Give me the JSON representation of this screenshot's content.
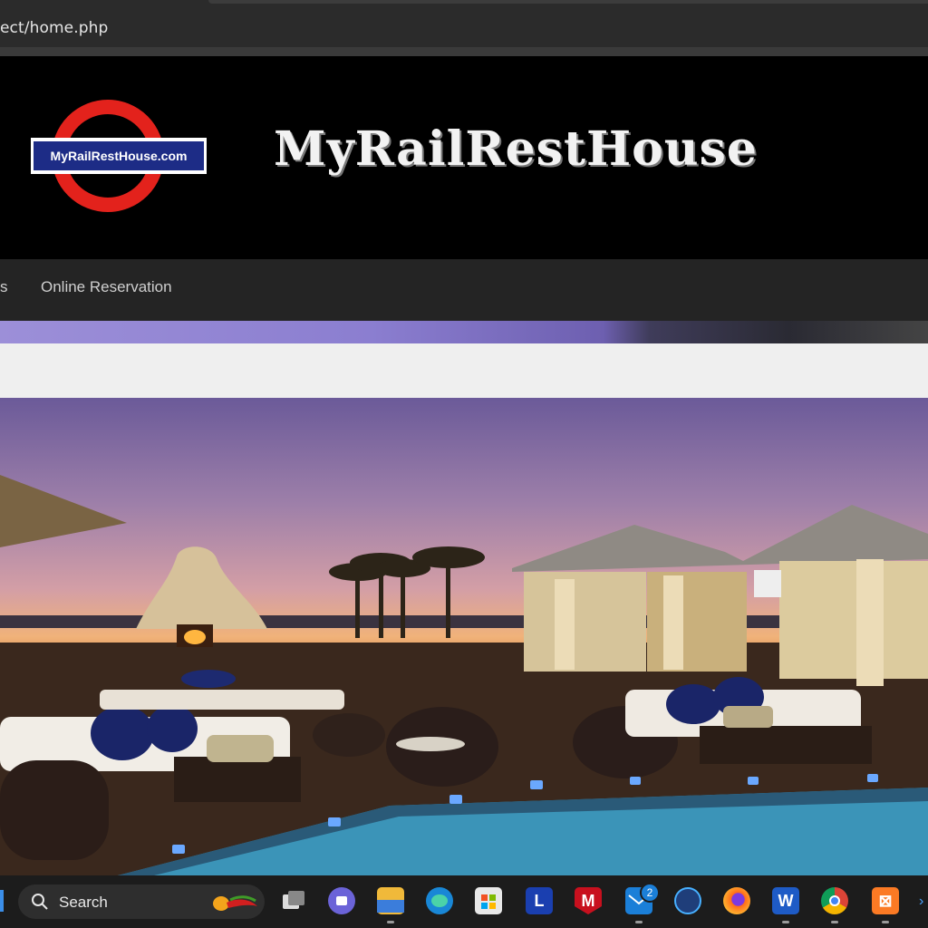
{
  "browser": {
    "url": "ect/home.php"
  },
  "header": {
    "logo_text": "MyRailRestHouse.com",
    "site_title": "MyRailRestHouse"
  },
  "nav": {
    "items": [
      {
        "label": "s"
      },
      {
        "label": "Online Reservation"
      }
    ]
  },
  "hero": {
    "subject": "rooftop-pool-lounge"
  },
  "taskbar": {
    "search_label": "Search",
    "mail_badge": "2",
    "icons": [
      "task-view-icon",
      "meet-icon",
      "file-explorer-icon",
      "edge-icon",
      "store-icon",
      "l-app-icon",
      "mcafee-icon",
      "mail-icon",
      "browser-app-icon",
      "firefox-icon",
      "word-icon",
      "chrome-icon",
      "xampp-icon"
    ]
  },
  "colors": {
    "logo_ring": "#e3221c",
    "logo_bar": "#1d2c86",
    "nav_bg": "#242424",
    "header_bg": "#000000"
  }
}
